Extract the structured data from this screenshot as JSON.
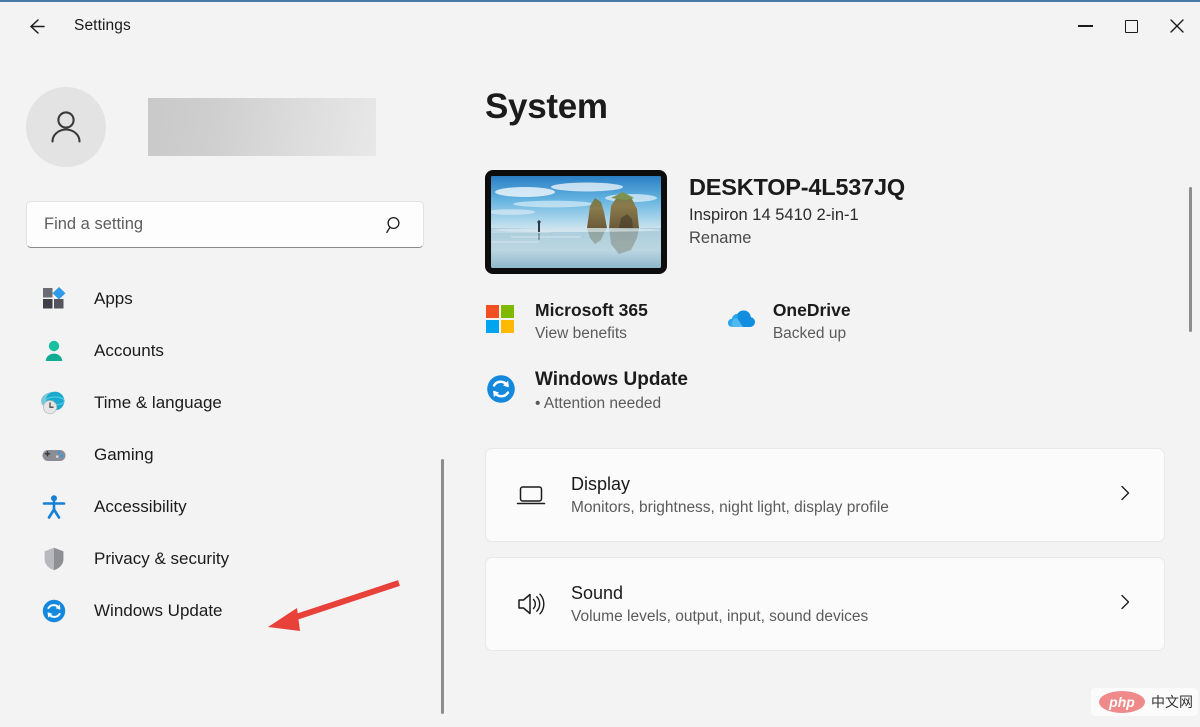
{
  "window": {
    "title": "Settings",
    "back_icon": "back-arrow-icon",
    "minimize_label": "Minimize",
    "maximize_label": "Maximize",
    "close_label": "Close"
  },
  "sidebar": {
    "account": {
      "avatar_icon": "person-avatar-icon",
      "name_redacted": ""
    },
    "search": {
      "placeholder": "Find a setting",
      "value": "",
      "icon": "search-icon"
    },
    "items": [
      {
        "label": "Apps",
        "icon": "apps-icon"
      },
      {
        "label": "Accounts",
        "icon": "accounts-icon"
      },
      {
        "label": "Time & language",
        "icon": "time-language-icon"
      },
      {
        "label": "Gaming",
        "icon": "gaming-icon"
      },
      {
        "label": "Accessibility",
        "icon": "accessibility-icon"
      },
      {
        "label": "Privacy & security",
        "icon": "privacy-security-icon"
      },
      {
        "label": "Windows Update",
        "icon": "windows-update-icon"
      }
    ]
  },
  "main": {
    "page_title": "System",
    "device": {
      "name": "DESKTOP-4L537JQ",
      "model": "Inspiron 14 5410 2-in-1",
      "rename_label": "Rename",
      "thumbnail_icon": "desktop-wallpaper-thumbnail"
    },
    "services": [
      {
        "title": "Microsoft 365",
        "subtitle": "View benefits",
        "icon": "microsoft-365-icon"
      },
      {
        "title": "OneDrive",
        "subtitle": "Backed up",
        "icon": "onedrive-icon"
      }
    ],
    "update": {
      "title": "Windows Update",
      "status": "• Attention needed",
      "icon": "windows-update-icon"
    },
    "cards": [
      {
        "title": "Display",
        "subtitle": "Monitors, brightness, night light, display profile",
        "icon": "display-monitor-icon",
        "chevron": "chevron-right-icon"
      },
      {
        "title": "Sound",
        "subtitle": "Volume levels, output, input, sound devices",
        "icon": "sound-speaker-icon",
        "chevron": "chevron-right-icon"
      }
    ]
  },
  "annotation": {
    "arrow_color": "#e8413a",
    "arrow_target": "Privacy & security"
  },
  "watermark": {
    "logo_text": "php",
    "site_text": "中文网"
  },
  "colors": {
    "window_bg": "#f3f3f3",
    "card_bg": "#fbfbfb",
    "text_primary": "#1b1b1b",
    "text_secondary": "#5b5b5b",
    "accent_blue": "#0078d4",
    "annotation_red": "#e8413a"
  }
}
